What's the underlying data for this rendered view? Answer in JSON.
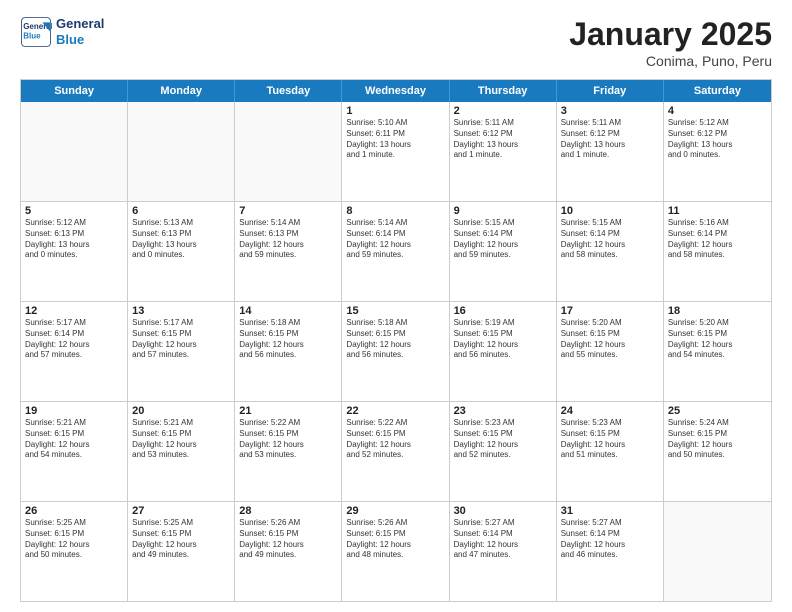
{
  "logo": {
    "line1": "General",
    "line2": "Blue"
  },
  "title": "January 2025",
  "subtitle": "Conima, Puno, Peru",
  "header_days": [
    "Sunday",
    "Monday",
    "Tuesday",
    "Wednesday",
    "Thursday",
    "Friday",
    "Saturday"
  ],
  "weeks": [
    [
      {
        "day": "",
        "info": ""
      },
      {
        "day": "",
        "info": ""
      },
      {
        "day": "",
        "info": ""
      },
      {
        "day": "1",
        "info": "Sunrise: 5:10 AM\nSunset: 6:11 PM\nDaylight: 13 hours\nand 1 minute."
      },
      {
        "day": "2",
        "info": "Sunrise: 5:11 AM\nSunset: 6:12 PM\nDaylight: 13 hours\nand 1 minute."
      },
      {
        "day": "3",
        "info": "Sunrise: 5:11 AM\nSunset: 6:12 PM\nDaylight: 13 hours\nand 1 minute."
      },
      {
        "day": "4",
        "info": "Sunrise: 5:12 AM\nSunset: 6:12 PM\nDaylight: 13 hours\nand 0 minutes."
      }
    ],
    [
      {
        "day": "5",
        "info": "Sunrise: 5:12 AM\nSunset: 6:13 PM\nDaylight: 13 hours\nand 0 minutes."
      },
      {
        "day": "6",
        "info": "Sunrise: 5:13 AM\nSunset: 6:13 PM\nDaylight: 13 hours\nand 0 minutes."
      },
      {
        "day": "7",
        "info": "Sunrise: 5:14 AM\nSunset: 6:13 PM\nDaylight: 12 hours\nand 59 minutes."
      },
      {
        "day": "8",
        "info": "Sunrise: 5:14 AM\nSunset: 6:14 PM\nDaylight: 12 hours\nand 59 minutes."
      },
      {
        "day": "9",
        "info": "Sunrise: 5:15 AM\nSunset: 6:14 PM\nDaylight: 12 hours\nand 59 minutes."
      },
      {
        "day": "10",
        "info": "Sunrise: 5:15 AM\nSunset: 6:14 PM\nDaylight: 12 hours\nand 58 minutes."
      },
      {
        "day": "11",
        "info": "Sunrise: 5:16 AM\nSunset: 6:14 PM\nDaylight: 12 hours\nand 58 minutes."
      }
    ],
    [
      {
        "day": "12",
        "info": "Sunrise: 5:17 AM\nSunset: 6:14 PM\nDaylight: 12 hours\nand 57 minutes."
      },
      {
        "day": "13",
        "info": "Sunrise: 5:17 AM\nSunset: 6:15 PM\nDaylight: 12 hours\nand 57 minutes."
      },
      {
        "day": "14",
        "info": "Sunrise: 5:18 AM\nSunset: 6:15 PM\nDaylight: 12 hours\nand 56 minutes."
      },
      {
        "day": "15",
        "info": "Sunrise: 5:18 AM\nSunset: 6:15 PM\nDaylight: 12 hours\nand 56 minutes."
      },
      {
        "day": "16",
        "info": "Sunrise: 5:19 AM\nSunset: 6:15 PM\nDaylight: 12 hours\nand 56 minutes."
      },
      {
        "day": "17",
        "info": "Sunrise: 5:20 AM\nSunset: 6:15 PM\nDaylight: 12 hours\nand 55 minutes."
      },
      {
        "day": "18",
        "info": "Sunrise: 5:20 AM\nSunset: 6:15 PM\nDaylight: 12 hours\nand 54 minutes."
      }
    ],
    [
      {
        "day": "19",
        "info": "Sunrise: 5:21 AM\nSunset: 6:15 PM\nDaylight: 12 hours\nand 54 minutes."
      },
      {
        "day": "20",
        "info": "Sunrise: 5:21 AM\nSunset: 6:15 PM\nDaylight: 12 hours\nand 53 minutes."
      },
      {
        "day": "21",
        "info": "Sunrise: 5:22 AM\nSunset: 6:15 PM\nDaylight: 12 hours\nand 53 minutes."
      },
      {
        "day": "22",
        "info": "Sunrise: 5:22 AM\nSunset: 6:15 PM\nDaylight: 12 hours\nand 52 minutes."
      },
      {
        "day": "23",
        "info": "Sunrise: 5:23 AM\nSunset: 6:15 PM\nDaylight: 12 hours\nand 52 minutes."
      },
      {
        "day": "24",
        "info": "Sunrise: 5:23 AM\nSunset: 6:15 PM\nDaylight: 12 hours\nand 51 minutes."
      },
      {
        "day": "25",
        "info": "Sunrise: 5:24 AM\nSunset: 6:15 PM\nDaylight: 12 hours\nand 50 minutes."
      }
    ],
    [
      {
        "day": "26",
        "info": "Sunrise: 5:25 AM\nSunset: 6:15 PM\nDaylight: 12 hours\nand 50 minutes."
      },
      {
        "day": "27",
        "info": "Sunrise: 5:25 AM\nSunset: 6:15 PM\nDaylight: 12 hours\nand 49 minutes."
      },
      {
        "day": "28",
        "info": "Sunrise: 5:26 AM\nSunset: 6:15 PM\nDaylight: 12 hours\nand 49 minutes."
      },
      {
        "day": "29",
        "info": "Sunrise: 5:26 AM\nSunset: 6:15 PM\nDaylight: 12 hours\nand 48 minutes."
      },
      {
        "day": "30",
        "info": "Sunrise: 5:27 AM\nSunset: 6:14 PM\nDaylight: 12 hours\nand 47 minutes."
      },
      {
        "day": "31",
        "info": "Sunrise: 5:27 AM\nSunset: 6:14 PM\nDaylight: 12 hours\nand 46 minutes."
      },
      {
        "day": "",
        "info": ""
      }
    ]
  ]
}
